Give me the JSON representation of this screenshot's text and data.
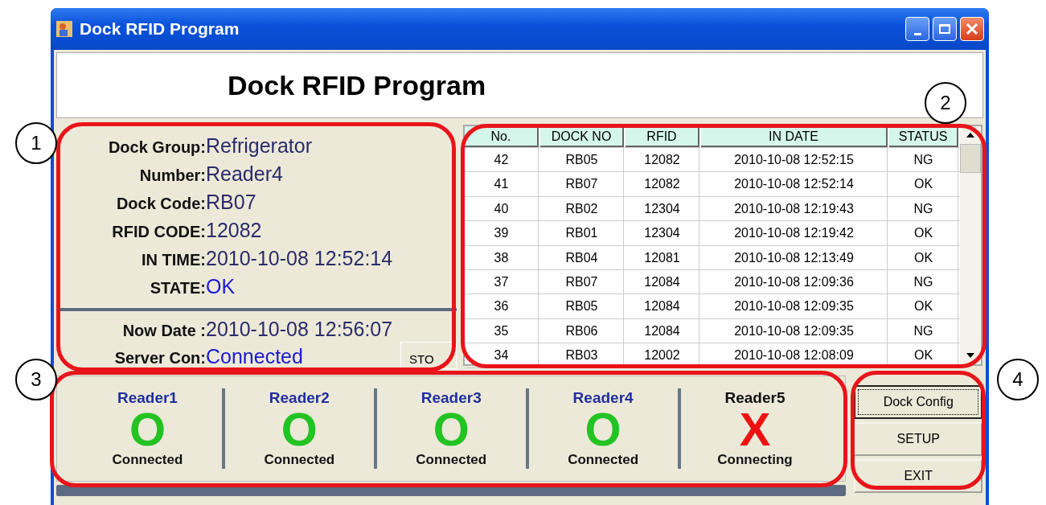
{
  "window": {
    "title": "Dock RFID Program"
  },
  "header": {
    "title": "Dock RFID Program"
  },
  "info_fields": [
    {
      "label": "Dock Group:",
      "value": "Refrigerator",
      "color": "#2b2b6b"
    },
    {
      "label": "Number:",
      "value": "Reader4",
      "color": "#2b2b6b"
    },
    {
      "label": "Dock Code:",
      "value": "RB07",
      "color": "#2b2b6b"
    },
    {
      "label": "RFID CODE:",
      "value": "12082",
      "color": "#2b2b6b"
    },
    {
      "label": "IN TIME:",
      "value": "2010-10-08 12:52:14",
      "color": "#2b2b6b"
    },
    {
      "label": "STATE:",
      "value": "OK",
      "color": "#1a1ad6"
    }
  ],
  "status_fields": [
    {
      "label": "Now Date :",
      "value": "2010-10-08 12:56:07",
      "color": "#2b2b6b"
    },
    {
      "label": "Server Con:",
      "value": "Connected",
      "color": "#1a1ad6"
    }
  ],
  "stop_button": {
    "label": "STO"
  },
  "table": {
    "columns": [
      "No.",
      "DOCK NO",
      "RFID",
      "IN DATE",
      "STATUS"
    ],
    "rows": [
      [
        "42",
        "RB05",
        "12082",
        "2010-10-08 12:52:15",
        "NG"
      ],
      [
        "41",
        "RB07",
        "12082",
        "2010-10-08 12:52:14",
        "OK"
      ],
      [
        "40",
        "RB02",
        "12304",
        "2010-10-08 12:19:43",
        "NG"
      ],
      [
        "39",
        "RB01",
        "12304",
        "2010-10-08 12:19:42",
        "OK"
      ],
      [
        "38",
        "RB04",
        "12081",
        "2010-10-08 12:13:49",
        "OK"
      ],
      [
        "37",
        "RB07",
        "12084",
        "2010-10-08 12:09:36",
        "NG"
      ],
      [
        "36",
        "RB05",
        "12084",
        "2010-10-08 12:09:35",
        "OK"
      ],
      [
        "35",
        "RB06",
        "12084",
        "2010-10-08 12:09:35",
        "NG"
      ],
      [
        "34",
        "RB03",
        "12002",
        "2010-10-08 12:08:09",
        "OK"
      ]
    ]
  },
  "readers": [
    {
      "name": "Reader1",
      "symbol": "O",
      "status": "Connected",
      "connected": true
    },
    {
      "name": "Reader2",
      "symbol": "O",
      "status": "Connected",
      "connected": true
    },
    {
      "name": "Reader3",
      "symbol": "O",
      "status": "Connected",
      "connected": true
    },
    {
      "name": "Reader4",
      "symbol": "O",
      "status": "Connected",
      "connected": true
    },
    {
      "name": "Reader5",
      "symbol": "X",
      "status": "Connecting",
      "connected": false
    }
  ],
  "buttons": [
    {
      "label": "Dock Config",
      "focused": true
    },
    {
      "label": "SETUP",
      "focused": false
    },
    {
      "label": "EXIT",
      "focused": false
    }
  ],
  "callouts": [
    {
      "label": "1"
    },
    {
      "label": "2"
    },
    {
      "label": "3"
    },
    {
      "label": "4"
    }
  ]
}
